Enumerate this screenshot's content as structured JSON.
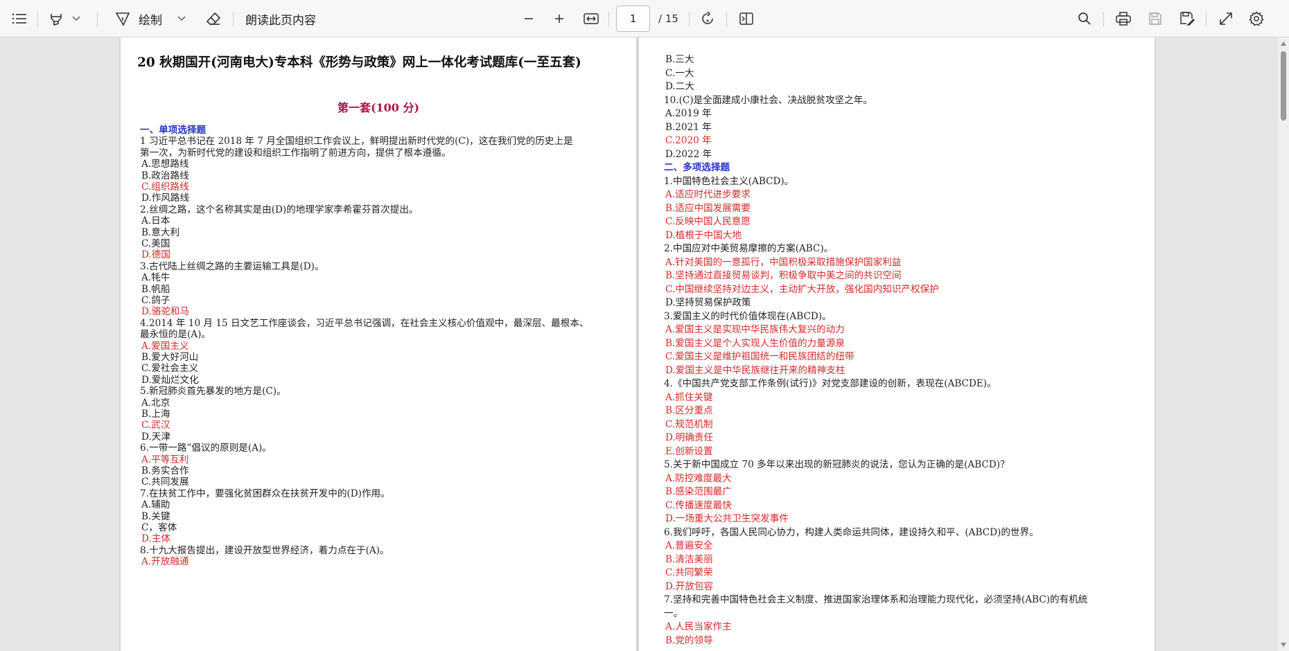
{
  "toolbar": {
    "draw_label": "绘制",
    "read_aloud_label": "朗读此页内容",
    "page_current": "1",
    "page_total": "/ 15",
    "icons": {
      "contents": "list-icon",
      "highlight": "highlighter-icon",
      "draw": "pen-icon",
      "erase": "eraser-icon",
      "zoom_out": "minus-icon",
      "zoom_in": "plus-icon",
      "fit": "fit-width-icon",
      "rotate": "rotate-icon",
      "page_view": "page-view-icon",
      "search": "search-icon",
      "print": "print-icon",
      "save": "save-icon",
      "save_as": "save-as-icon",
      "fullscreen": "expand-icon",
      "settings": "gear-icon"
    }
  },
  "colors": {
    "answer": "#d42a2a",
    "section": "#2a33c8",
    "set_title": "#b0124a"
  },
  "left_page": {
    "title": "20 秋期国开(河南电大)专本科《形势与政策》网上一体化考试题库(一至五套)",
    "set_title": "第一套(100 分)",
    "lines": [
      {
        "t": "一、单项选择题",
        "s": "blue"
      },
      {
        "t": "1 习近平总书记在 2018 年 7 月全国组织工作会议上，鲜明提出新时代党的(C)，这在我们党的历史上是",
        "s": ""
      },
      {
        "t": "第一次，为新时代党的建设和组织工作指明了前进方向，提供了根本遵循。",
        "s": ""
      },
      {
        "t": "A.思想路线",
        "s": ""
      },
      {
        "t": "B.政治路线",
        "s": ""
      },
      {
        "t": "C.组织路线",
        "s": "red"
      },
      {
        "t": "D.作风路线",
        "s": ""
      },
      {
        "t": "2.丝绸之路，这个名称其实是由(D)的地理学家李希霍芬首次提出。",
        "s": ""
      },
      {
        "t": "A.日本",
        "s": ""
      },
      {
        "t": "B.意大利",
        "s": ""
      },
      {
        "t": "C.美国",
        "s": ""
      },
      {
        "t": "D.德国",
        "s": "red"
      },
      {
        "t": "3.古代陆上丝绸之路的主要运输工具是(D)。",
        "s": ""
      },
      {
        "t": "A.牦牛",
        "s": ""
      },
      {
        "t": "B.帆船",
        "s": ""
      },
      {
        "t": "C.鸽子",
        "s": ""
      },
      {
        "t": "D.骆驼和马",
        "s": "red"
      },
      {
        "t": "4.2014 年 10 月 15 日文艺工作座谈会，习近平总书记强调，在社会主义核心价值观中，最深层、最根本、",
        "s": ""
      },
      {
        "t": "最永恒的是(A)。",
        "s": ""
      },
      {
        "t": "A.爱国主义",
        "s": "red"
      },
      {
        "t": "B.爱大好河山",
        "s": ""
      },
      {
        "t": "C.爱社会主义",
        "s": ""
      },
      {
        "t": "D.爱灿烂文化",
        "s": ""
      },
      {
        "t": "5.新冠肺炎首先暴发的地方是(C)。",
        "s": ""
      },
      {
        "t": "A.北京",
        "s": ""
      },
      {
        "t": "B.上海",
        "s": ""
      },
      {
        "t": "C.武汉",
        "s": "red"
      },
      {
        "t": "D.天津",
        "s": ""
      },
      {
        "t": "6.一带一路”倡议的原则是(A)。",
        "s": ""
      },
      {
        "t": "A.平等互利",
        "s": "red"
      },
      {
        "t": "B.务实合作",
        "s": ""
      },
      {
        "t": "C.共同发展",
        "s": ""
      },
      {
        "t": "7.在扶贫工作中，要强化贫困群众在扶贫开发中的(D)作用。",
        "s": ""
      },
      {
        "t": "A.辅助",
        "s": ""
      },
      {
        "t": "B.关键",
        "s": ""
      },
      {
        "t": "C，客体",
        "s": ""
      },
      {
        "t": "D.主体",
        "s": "red"
      },
      {
        "t": "8.十九大报告提出，建设开放型世界经济，着力点在于(A)。",
        "s": ""
      },
      {
        "t": "A.开放融通",
        "s": "red"
      }
    ]
  },
  "right_page": {
    "lines": [
      {
        "t": "B.三大",
        "s": ""
      },
      {
        "t": "C.一大",
        "s": ""
      },
      {
        "t": "D.二大",
        "s": ""
      },
      {
        "t": "10.(C)是全面建成小康社会、决战脱贫攻坚之年。",
        "s": ""
      },
      {
        "t": "A.2019 年",
        "s": ""
      },
      {
        "t": "B.2021 年",
        "s": ""
      },
      {
        "t": "C.2020 年",
        "s": "red"
      },
      {
        "t": "D.2022 年",
        "s": ""
      },
      {
        "t": "二、多项选择题",
        "s": "blue"
      },
      {
        "t": "1.中国特色社会主义(ABCD)。",
        "s": ""
      },
      {
        "t": "A.适应时代进步要求",
        "s": "red"
      },
      {
        "t": "B.适应中国发展需要",
        "s": "red"
      },
      {
        "t": "C.反映中国人民意愿",
        "s": "red"
      },
      {
        "t": "D.植根于中国大地",
        "s": "red"
      },
      {
        "t": "2.中国应对中美贸易摩擦的方案(ABC)。",
        "s": ""
      },
      {
        "t": "A.针对美国的一意孤行，中国积极采取措施保护国家利益",
        "s": "red"
      },
      {
        "t": "B.坚持通过直接贸易谈判，积极争取中美之间的共识空间",
        "s": "red"
      },
      {
        "t": "C.中国继续坚持对边主义，主动扩大开放，强化国内知识产权保护",
        "s": "red"
      },
      {
        "t": "D.坚持贸易保护政策",
        "s": ""
      },
      {
        "t": "3.爱国主义的时代价值体现在(ABCD)。",
        "s": ""
      },
      {
        "t": "A.爱国主义是实现中华民族伟大复兴的动力",
        "s": "red"
      },
      {
        "t": "B.爱国主义是个人实现人生价值的力量源泉",
        "s": "red"
      },
      {
        "t": "C.爱国主义是维护祖国统一和民族团结的纽带",
        "s": "red"
      },
      {
        "t": "D.爱国主义是中华民族继往开来的精神支柱",
        "s": "red"
      },
      {
        "t": "4.《中国共产党支部工作条例(试行)》对党支部建设的创新，表现在(ABCDE)。",
        "s": ""
      },
      {
        "t": "A.抓住关键",
        "s": "red"
      },
      {
        "t": "B.区分重点",
        "s": "red"
      },
      {
        "t": "C.规范机制",
        "s": "red"
      },
      {
        "t": "D.明确责任",
        "s": "red"
      },
      {
        "t": "E.创新设置",
        "s": "red"
      },
      {
        "t": "5.关于新中国成立 70 多年以来出现的新冠肺炎的说法，您认为正确的是(ABCD)？",
        "s": ""
      },
      {
        "t": "A.防控难度最大",
        "s": "red"
      },
      {
        "t": "B.感染范围最广",
        "s": "red"
      },
      {
        "t": "C.传播速度最快",
        "s": "red"
      },
      {
        "t": "D.一场重大公共卫生突发事件",
        "s": "red"
      },
      {
        "t": "6.我们呼吁，各国人民同心协力，构建人类命运共同体，建设持久和平、(ABCD)的世界。",
        "s": ""
      },
      {
        "t": "A.普遍安全",
        "s": "red"
      },
      {
        "t": "B.清洁美丽",
        "s": "red"
      },
      {
        "t": "C.共同繁荣",
        "s": "red"
      },
      {
        "t": "D.开放包容",
        "s": "red"
      },
      {
        "t": "7.坚持和完善中国特色社会主义制度、推进国家治理体系和治理能力现代化，必须坚持(ABC)的有机统",
        "s": ""
      },
      {
        "t": "一。",
        "s": ""
      },
      {
        "t": "A.人民当家作主",
        "s": "red"
      },
      {
        "t": "B.党的领导",
        "s": "red"
      }
    ]
  }
}
